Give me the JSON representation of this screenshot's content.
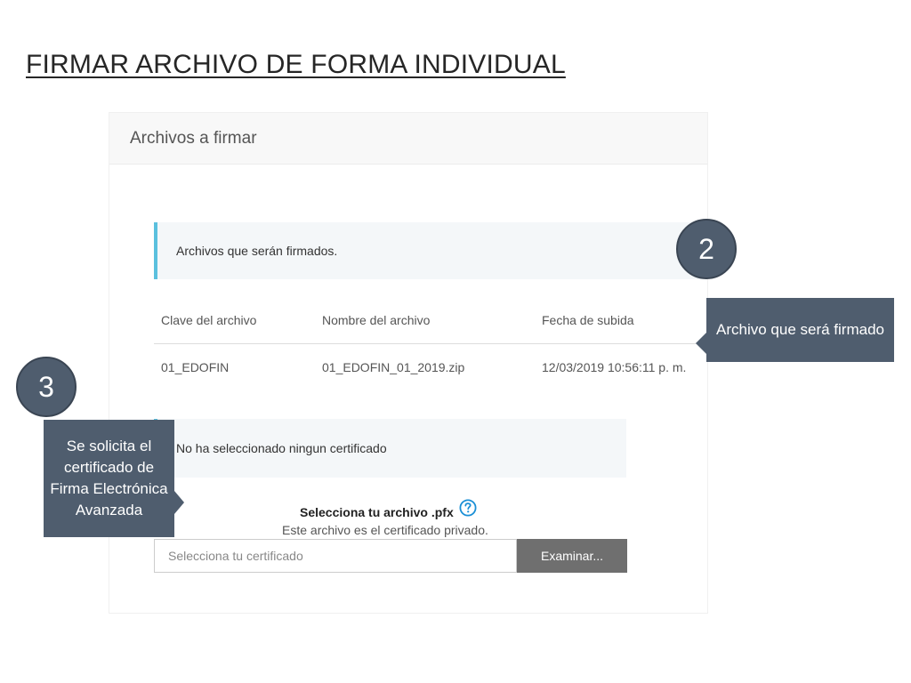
{
  "slide": {
    "title": "FIRMAR ARCHIVO DE FORMA INDIVIDUAL"
  },
  "panel": {
    "title": "Archivos a firmar",
    "info_message": "Archivos que serán firmados.",
    "table": {
      "headers": [
        "Clave del archivo",
        "Nombre del archivo",
        "Fecha de subida"
      ],
      "rows": [
        [
          "01_EDOFIN",
          "01_EDOFIN_01_2019.zip",
          "12/03/2019 10:56:11 p. m."
        ]
      ]
    },
    "warning_message": "No ha seleccionado ningun certificado",
    "file_select": {
      "label": "Selecciona tu archivo .pfx",
      "help_icon": "question-circle-icon",
      "subtext": "Este archivo es el certificado privado.",
      "placeholder": "Selecciona tu certificado",
      "value": "",
      "button_label": "Examinar..."
    }
  },
  "callouts": {
    "two": {
      "number": "2",
      "text": "Archivo que será firmado"
    },
    "three": {
      "number": "3",
      "text": "Se solicita el certificado de Firma Electrónica Avanzada"
    }
  },
  "colors": {
    "accent_border": "#5bc0de",
    "callout_bg": "#4f5d6e",
    "button_bg": "#6f6f6f",
    "help_icon": "#1a8fd6"
  }
}
